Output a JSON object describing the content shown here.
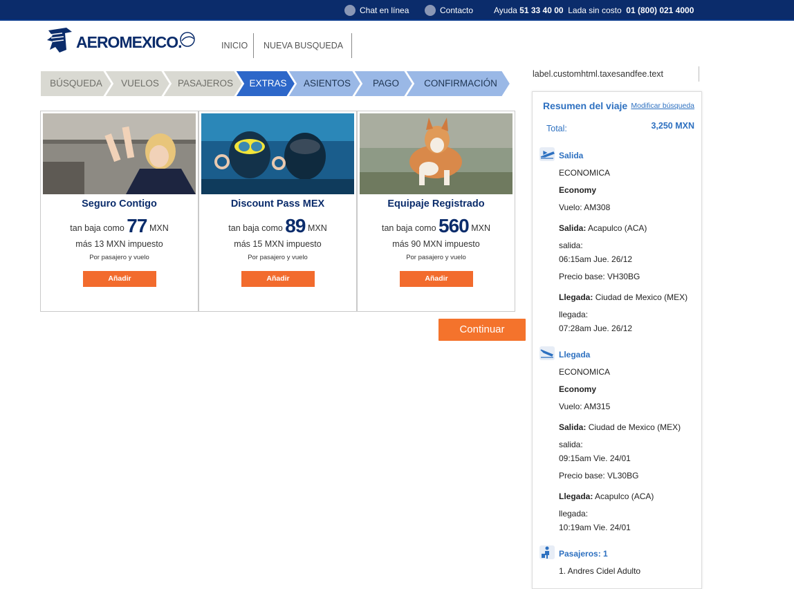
{
  "topbar": {
    "chat": "Chat en línea",
    "contact": "Contacto",
    "help_label": "Ayuda",
    "help_phone": "51 33 40 00",
    "free_label": "Lada sin costo",
    "free_phone": "01 (800) 021 4000"
  },
  "brand": {
    "logo_text": "AEROMEXICO."
  },
  "nav": {
    "home": "INICIO",
    "new_search": "NUEVA BUSQUEDA"
  },
  "steps": [
    {
      "label": "BÚSQUEDA",
      "state": "done"
    },
    {
      "label": "VUELOS",
      "state": "done"
    },
    {
      "label": "PASAJEROS",
      "state": "done"
    },
    {
      "label": "EXTRAS",
      "state": "active"
    },
    {
      "label": "ASIENTOS",
      "state": "pending"
    },
    {
      "label": "PAGO",
      "state": "pending"
    },
    {
      "label": "CONFIRMACIÓN",
      "state": "pending"
    }
  ],
  "cards": [
    {
      "title": "Seguro Contigo",
      "prefix": "tan baja como",
      "price": "77",
      "currency": "MXN",
      "tax": "más 13 MXN impuesto",
      "per": "Por pasajero y vuelo",
      "button": "Añadir"
    },
    {
      "title": "Discount Pass MEX",
      "prefix": "tan baja como",
      "price": "89",
      "currency": "MXN",
      "tax": "más 15 MXN impuesto",
      "per": "Por pasajero y vuelo",
      "button": "Añadir"
    },
    {
      "title": "Equipaje Registrado",
      "prefix": "tan baja como",
      "price": "560",
      "currency": "MXN",
      "tax": "más 90 MXN impuesto",
      "per": "Por pasajero y vuelo",
      "button": "Añadir"
    }
  ],
  "continue_button": "Continuar",
  "side": {
    "label_key": "label.customhtml.taxesandfee.text",
    "title": "Resumen del viaje",
    "modify": "Modificar búsqueda",
    "total_label": "Total:",
    "total_value": "3,250 MXN",
    "outbound": {
      "heading": "Salida",
      "cabin": "ECONOMICA",
      "class": "Economy",
      "flight": "Vuelo: AM308",
      "dep_label": "Salida:",
      "dep_city": "Acapulco (ACA)",
      "dep_sub": "salida:",
      "dep_time": "06:15am Jue. 26/12",
      "base": "Precio base: VH30BG",
      "arr_label": "Llegada:",
      "arr_city": "Ciudad de Mexico (MEX)",
      "arr_sub": "llegada:",
      "arr_time": "07:28am Jue. 26/12"
    },
    "return": {
      "heading": "Llegada",
      "cabin": "ECONOMICA",
      "class": "Economy",
      "flight": "Vuelo: AM315",
      "dep_label": "Salida:",
      "dep_city": "Ciudad de Mexico (MEX)",
      "dep_sub": "salida:",
      "dep_time": "09:15am Vie. 24/01",
      "base": "Precio base: VL30BG",
      "arr_label": "Llegada:",
      "arr_city": "Acapulco (ACA)",
      "arr_sub": "llegada:",
      "arr_time": "10:19am Vie. 24/01"
    },
    "passengers": {
      "heading": "Pasajeros: 1",
      "list": [
        "1. Andres Cidel Adulto"
      ]
    }
  },
  "colors": {
    "navy": "#0b2c6b",
    "accent_blue": "#2d70c0",
    "step_done": "#d9d9d2",
    "step_active": "#2d67c9",
    "step_pending": "#9ab8e6",
    "orange": "#f26b2d"
  },
  "icons": [
    "chat-icon",
    "contact-icon",
    "airline-logo-icon",
    "takeoff-icon",
    "landing-icon",
    "passenger-icon"
  ]
}
